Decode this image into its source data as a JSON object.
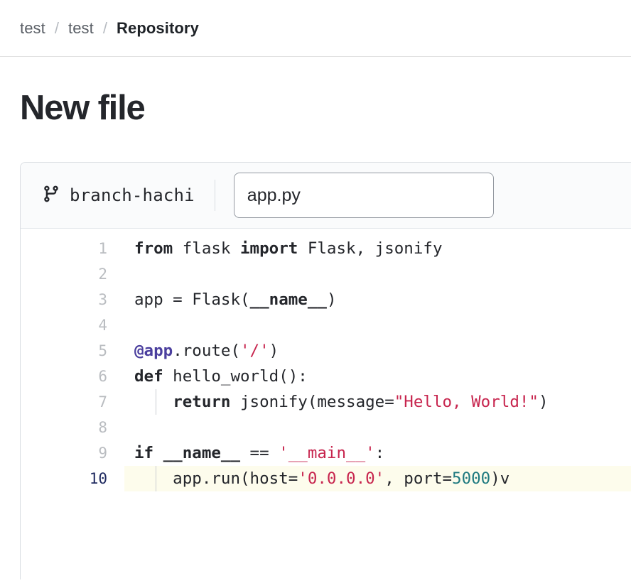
{
  "breadcrumb": {
    "items": [
      {
        "label": "test",
        "current": false
      },
      {
        "label": "test",
        "current": false
      },
      {
        "label": "Repository",
        "current": true
      }
    ],
    "separator": "/"
  },
  "page": {
    "title": "New file"
  },
  "editor": {
    "branch": {
      "name": "branch-hachi",
      "icon": "git-branch-icon"
    },
    "filename": {
      "value": "app.py",
      "placeholder": "Name your file..."
    },
    "colors": {
      "keyword": "#24262b",
      "string": "#c7254e",
      "number": "#1f7a80",
      "decorator": "#4b3f9e",
      "active_line_bg": "#fdfcec",
      "active_line_number": "#1f2a60",
      "line_number": "#b9bcc0"
    },
    "lines": [
      {
        "number": "1",
        "active": false,
        "indent_guide": false,
        "tokens": [
          {
            "t": "from",
            "c": "kw"
          },
          {
            "t": " flask ",
            "c": "plain"
          },
          {
            "t": "import",
            "c": "kw"
          },
          {
            "t": " Flask, jsonify",
            "c": "plain"
          }
        ]
      },
      {
        "number": "2",
        "active": false,
        "indent_guide": false,
        "tokens": []
      },
      {
        "number": "3",
        "active": false,
        "indent_guide": false,
        "tokens": [
          {
            "t": "app = Flask(",
            "c": "plain"
          },
          {
            "t": "__name__",
            "c": "kw"
          },
          {
            "t": ")",
            "c": "plain"
          }
        ]
      },
      {
        "number": "4",
        "active": false,
        "indent_guide": false,
        "tokens": []
      },
      {
        "number": "5",
        "active": false,
        "indent_guide": false,
        "tokens": [
          {
            "t": "@app",
            "c": "dec"
          },
          {
            "t": ".route(",
            "c": "plain"
          },
          {
            "t": "'/'",
            "c": "str"
          },
          {
            "t": ")",
            "c": "plain"
          }
        ]
      },
      {
        "number": "6",
        "active": false,
        "indent_guide": false,
        "tokens": [
          {
            "t": "def",
            "c": "kw"
          },
          {
            "t": " hello_world():",
            "c": "plain"
          }
        ]
      },
      {
        "number": "7",
        "active": false,
        "indent_guide": true,
        "tokens": [
          {
            "t": "    ",
            "c": "plain"
          },
          {
            "t": "return",
            "c": "kw"
          },
          {
            "t": " jsonify(message=",
            "c": "plain"
          },
          {
            "t": "\"Hello, World!\"",
            "c": "str"
          },
          {
            "t": ")",
            "c": "plain"
          }
        ]
      },
      {
        "number": "8",
        "active": false,
        "indent_guide": false,
        "tokens": []
      },
      {
        "number": "9",
        "active": false,
        "indent_guide": false,
        "tokens": [
          {
            "t": "if",
            "c": "kw"
          },
          {
            "t": " ",
            "c": "plain"
          },
          {
            "t": "__name__",
            "c": "kw"
          },
          {
            "t": " == ",
            "c": "plain"
          },
          {
            "t": "'__main__'",
            "c": "str"
          },
          {
            "t": ":",
            "c": "plain"
          }
        ]
      },
      {
        "number": "10",
        "active": true,
        "indent_guide": true,
        "tokens": [
          {
            "t": "    app.run(host=",
            "c": "plain"
          },
          {
            "t": "'0.0.0.0'",
            "c": "str"
          },
          {
            "t": ", port=",
            "c": "plain"
          },
          {
            "t": "5000",
            "c": "num"
          },
          {
            "t": ")v",
            "c": "plain"
          }
        ]
      }
    ]
  }
}
